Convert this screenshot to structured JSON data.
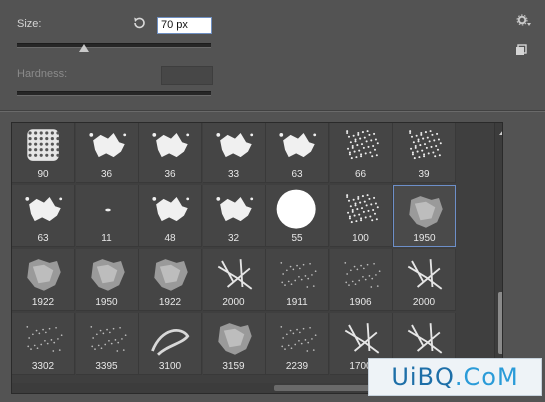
{
  "size": {
    "label": "Size:",
    "value": "70 px",
    "slider_fraction": 0.35
  },
  "hardness": {
    "label": "Hardness:",
    "value": ""
  },
  "icons": {
    "reset": "reset-size-icon",
    "gear": "gear-icon",
    "new_preset": "new-preset-icon"
  },
  "brushes": [
    {
      "size": "90",
      "kind": "texture"
    },
    {
      "size": "36",
      "kind": "splatter"
    },
    {
      "size": "36",
      "kind": "splatter"
    },
    {
      "size": "33",
      "kind": "splatter"
    },
    {
      "size": "63",
      "kind": "splatter"
    },
    {
      "size": "66",
      "kind": "spray"
    },
    {
      "size": "39",
      "kind": "spray"
    },
    {
      "size": "63",
      "kind": "splatter"
    },
    {
      "size": "11",
      "kind": "dot"
    },
    {
      "size": "48",
      "kind": "splatter"
    },
    {
      "size": "32",
      "kind": "splatter"
    },
    {
      "size": "55",
      "kind": "round"
    },
    {
      "size": "100",
      "kind": "spray"
    },
    {
      "size": "1950",
      "kind": "blot",
      "selected": true
    },
    {
      "size": "1922",
      "kind": "blot"
    },
    {
      "size": "1950",
      "kind": "blot"
    },
    {
      "size": "1922",
      "kind": "blot"
    },
    {
      "size": "2000",
      "kind": "splash"
    },
    {
      "size": "1911",
      "kind": "faint"
    },
    {
      "size": "1906",
      "kind": "faint"
    },
    {
      "size": "2000",
      "kind": "splash"
    },
    {
      "size": "3302",
      "kind": "faint"
    },
    {
      "size": "3395",
      "kind": "faint"
    },
    {
      "size": "3100",
      "kind": "swirl"
    },
    {
      "size": "3159",
      "kind": "blot"
    },
    {
      "size": "2239",
      "kind": "faint"
    },
    {
      "size": "1700",
      "kind": "splash"
    },
    {
      "size": "",
      "kind": "splash"
    }
  ],
  "watermark": {
    "text_a": "UiBQ",
    "text_b": ".CoM"
  }
}
